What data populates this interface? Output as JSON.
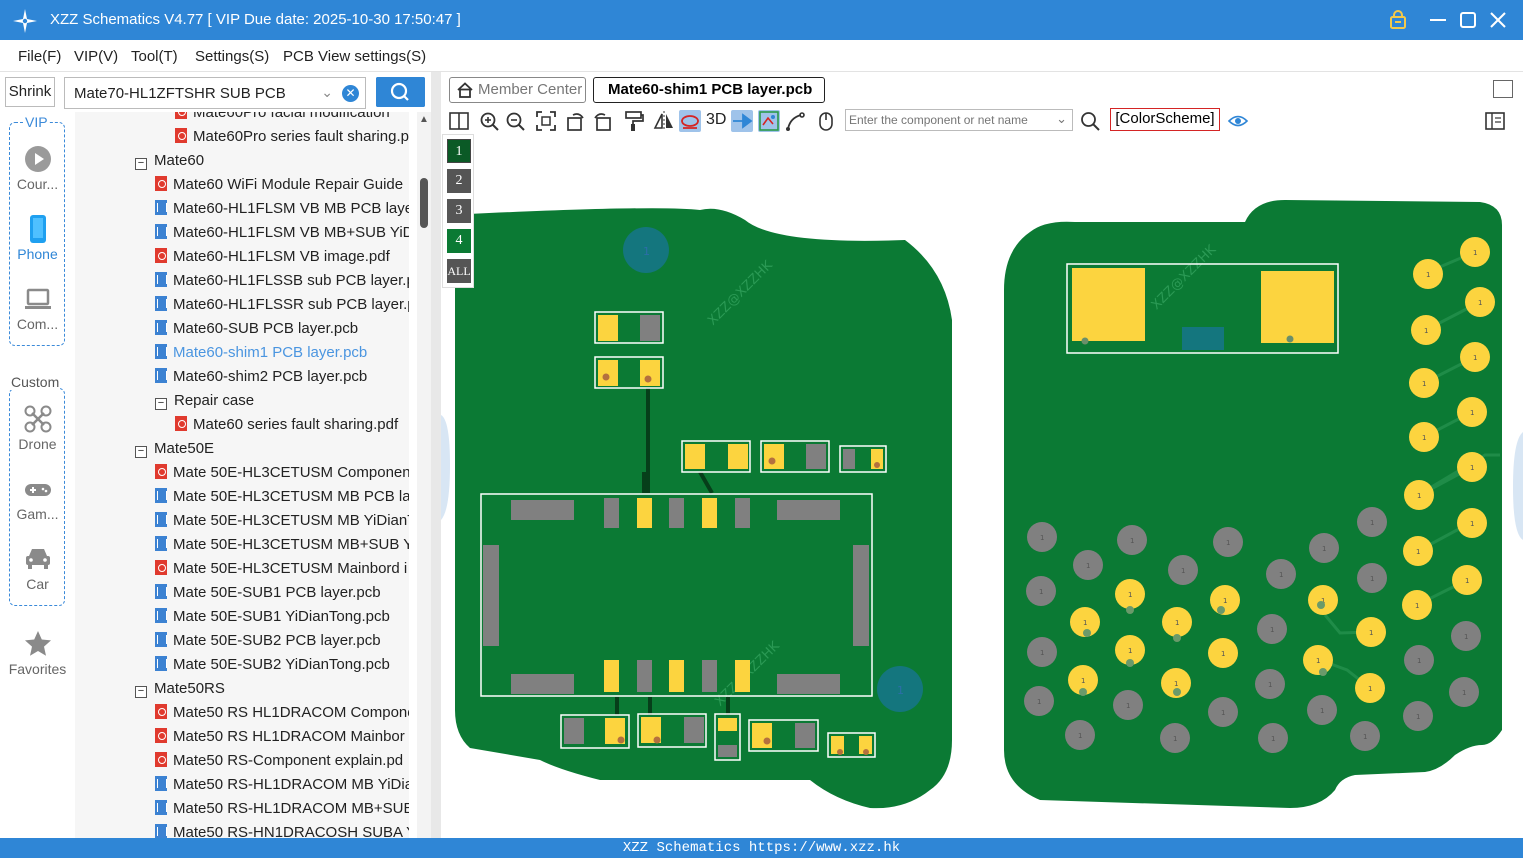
{
  "window": {
    "title": "XZZ Schematics V4.77 [ VIP Due date: 2025-10-30 17:50:47 ]",
    "controls": [
      "vip-lock-icon",
      "minimize-icon",
      "maximize-icon",
      "close-icon"
    ]
  },
  "menu": [
    "File(F)",
    "VIP(V)",
    "Tool(T)",
    "Settings(S)",
    "PCB View settings(S)"
  ],
  "sidebar": {
    "shrink_label": "Shrink",
    "vip_label": "VIP",
    "custom_label": "Custom",
    "items": [
      {
        "label": "Cour...",
        "icon": "play-icon"
      },
      {
        "label": "Phone",
        "icon": "phone-icon",
        "active": true
      },
      {
        "label": "Com...",
        "icon": "laptop-icon"
      },
      {
        "label": "Drone",
        "icon": "drone-icon"
      },
      {
        "label": "Gam...",
        "icon": "gamepad-icon"
      },
      {
        "label": "Car",
        "icon": "car-icon"
      },
      {
        "label": "Favorites",
        "icon": "star-icon"
      }
    ]
  },
  "search": {
    "value": "Mate70-HL1ZFTSHR SUB PCB"
  },
  "tree": [
    {
      "label": "Mate60Pro facial modification",
      "type": "pdf",
      "level": 2
    },
    {
      "label": "Mate60Pro series fault sharing.p",
      "type": "pdf",
      "level": 2
    },
    {
      "label": "Mate60",
      "type": "folder",
      "level": 0
    },
    {
      "label": "Mate60 WiFi Module Repair Guide",
      "type": "pdf",
      "level": 1
    },
    {
      "label": "Mate60-HL1FLSM VB MB PCB laye",
      "type": "pcb",
      "level": 1
    },
    {
      "label": "Mate60-HL1FLSM VB MB+SUB YiD",
      "type": "pcb",
      "level": 1
    },
    {
      "label": "Mate60-HL1FLSM VB image.pdf",
      "type": "pdf",
      "level": 1
    },
    {
      "label": "Mate60-HL1FLSSB sub PCB layer.p",
      "type": "pcb",
      "level": 1
    },
    {
      "label": "Mate60-HL1FLSSR sub PCB layer.p",
      "type": "pcb",
      "level": 1
    },
    {
      "label": "Mate60-SUB PCB layer.pcb",
      "type": "pcb",
      "level": 1
    },
    {
      "label": "Mate60-shim1 PCB layer.pcb",
      "type": "pcb",
      "level": 1,
      "active": true
    },
    {
      "label": "Mate60-shim2 PCB layer.pcb",
      "type": "pcb",
      "level": 1
    },
    {
      "label": "Repair case",
      "type": "folder",
      "level": 1
    },
    {
      "label": "Mate60 series fault sharing.pdf",
      "type": "pdf",
      "level": 2
    },
    {
      "label": "Mate50E",
      "type": "folder",
      "level": 0
    },
    {
      "label": "Mate 50E-HL3CETUSM Componen",
      "type": "pdf",
      "level": 1
    },
    {
      "label": "Mate 50E-HL3CETUSM MB PCB lay",
      "type": "pcb",
      "level": 1
    },
    {
      "label": "Mate 50E-HL3CETUSM MB YiDianT",
      "type": "pcb",
      "level": 1
    },
    {
      "label": "Mate 50E-HL3CETUSM MB+SUB Yi",
      "type": "pcb",
      "level": 1
    },
    {
      "label": "Mate 50E-HL3CETUSM Mainbord i",
      "type": "pdf",
      "level": 1
    },
    {
      "label": "Mate 50E-SUB1 PCB layer.pcb",
      "type": "pcb",
      "level": 1
    },
    {
      "label": "Mate 50E-SUB1 YiDianTong.pcb",
      "type": "pcb",
      "level": 1
    },
    {
      "label": "Mate 50E-SUB2 PCB layer.pcb",
      "type": "pcb",
      "level": 1
    },
    {
      "label": "Mate 50E-SUB2 YiDianTong.pcb",
      "type": "pcb",
      "level": 1
    },
    {
      "label": "Mate50RS",
      "type": "folder",
      "level": 0
    },
    {
      "label": "Mate50 RS HL1DRACOM Compone",
      "type": "pdf",
      "level": 1
    },
    {
      "label": "Mate50 RS HL1DRACOM Mainbor",
      "type": "pdf",
      "level": 1
    },
    {
      "label": "Mate50 RS-Component explain.pd",
      "type": "pdf",
      "level": 1
    },
    {
      "label": "Mate50 RS-HL1DRACOM MB YiDia",
      "type": "pcb",
      "level": 1
    },
    {
      "label": "Mate50 RS-HL1DRACOM MB+SUB",
      "type": "pcb",
      "level": 1
    },
    {
      "label": "Mate50 RS-HN1DRACOSH SUBA Y",
      "type": "pcb",
      "level": 1
    }
  ],
  "tabs": {
    "member": "Member Center",
    "active": "Mate60-shim1 PCB layer.pcb"
  },
  "toolbar": {
    "label_3d": "3D",
    "component_placeholder": "Enter the component or net name",
    "color_scheme": "[ColorScheme]",
    "icons": [
      "split-view-icon",
      "zoom-in-icon",
      "zoom-out-icon",
      "fit-icon",
      "rotate-left-icon",
      "rotate-right-icon",
      "paint-icon",
      "flip-icon",
      "highlight-icon",
      "pin-icon",
      "net-icon",
      "trace-icon",
      "mouse-icon",
      "search-icon",
      "eye-icon",
      "panel-toggle-icon"
    ]
  },
  "layers": [
    "1",
    "2",
    "3",
    "4",
    "ALL"
  ],
  "pcb": {
    "label_1": "1",
    "watermark": "XZZ@XZZHK",
    "colors": {
      "board": "#0b7a34",
      "pad": "#fcd43f",
      "grey": "#808080",
      "via": "#14767e"
    }
  },
  "status": "XZZ Schematics https://www.xzz.hk"
}
